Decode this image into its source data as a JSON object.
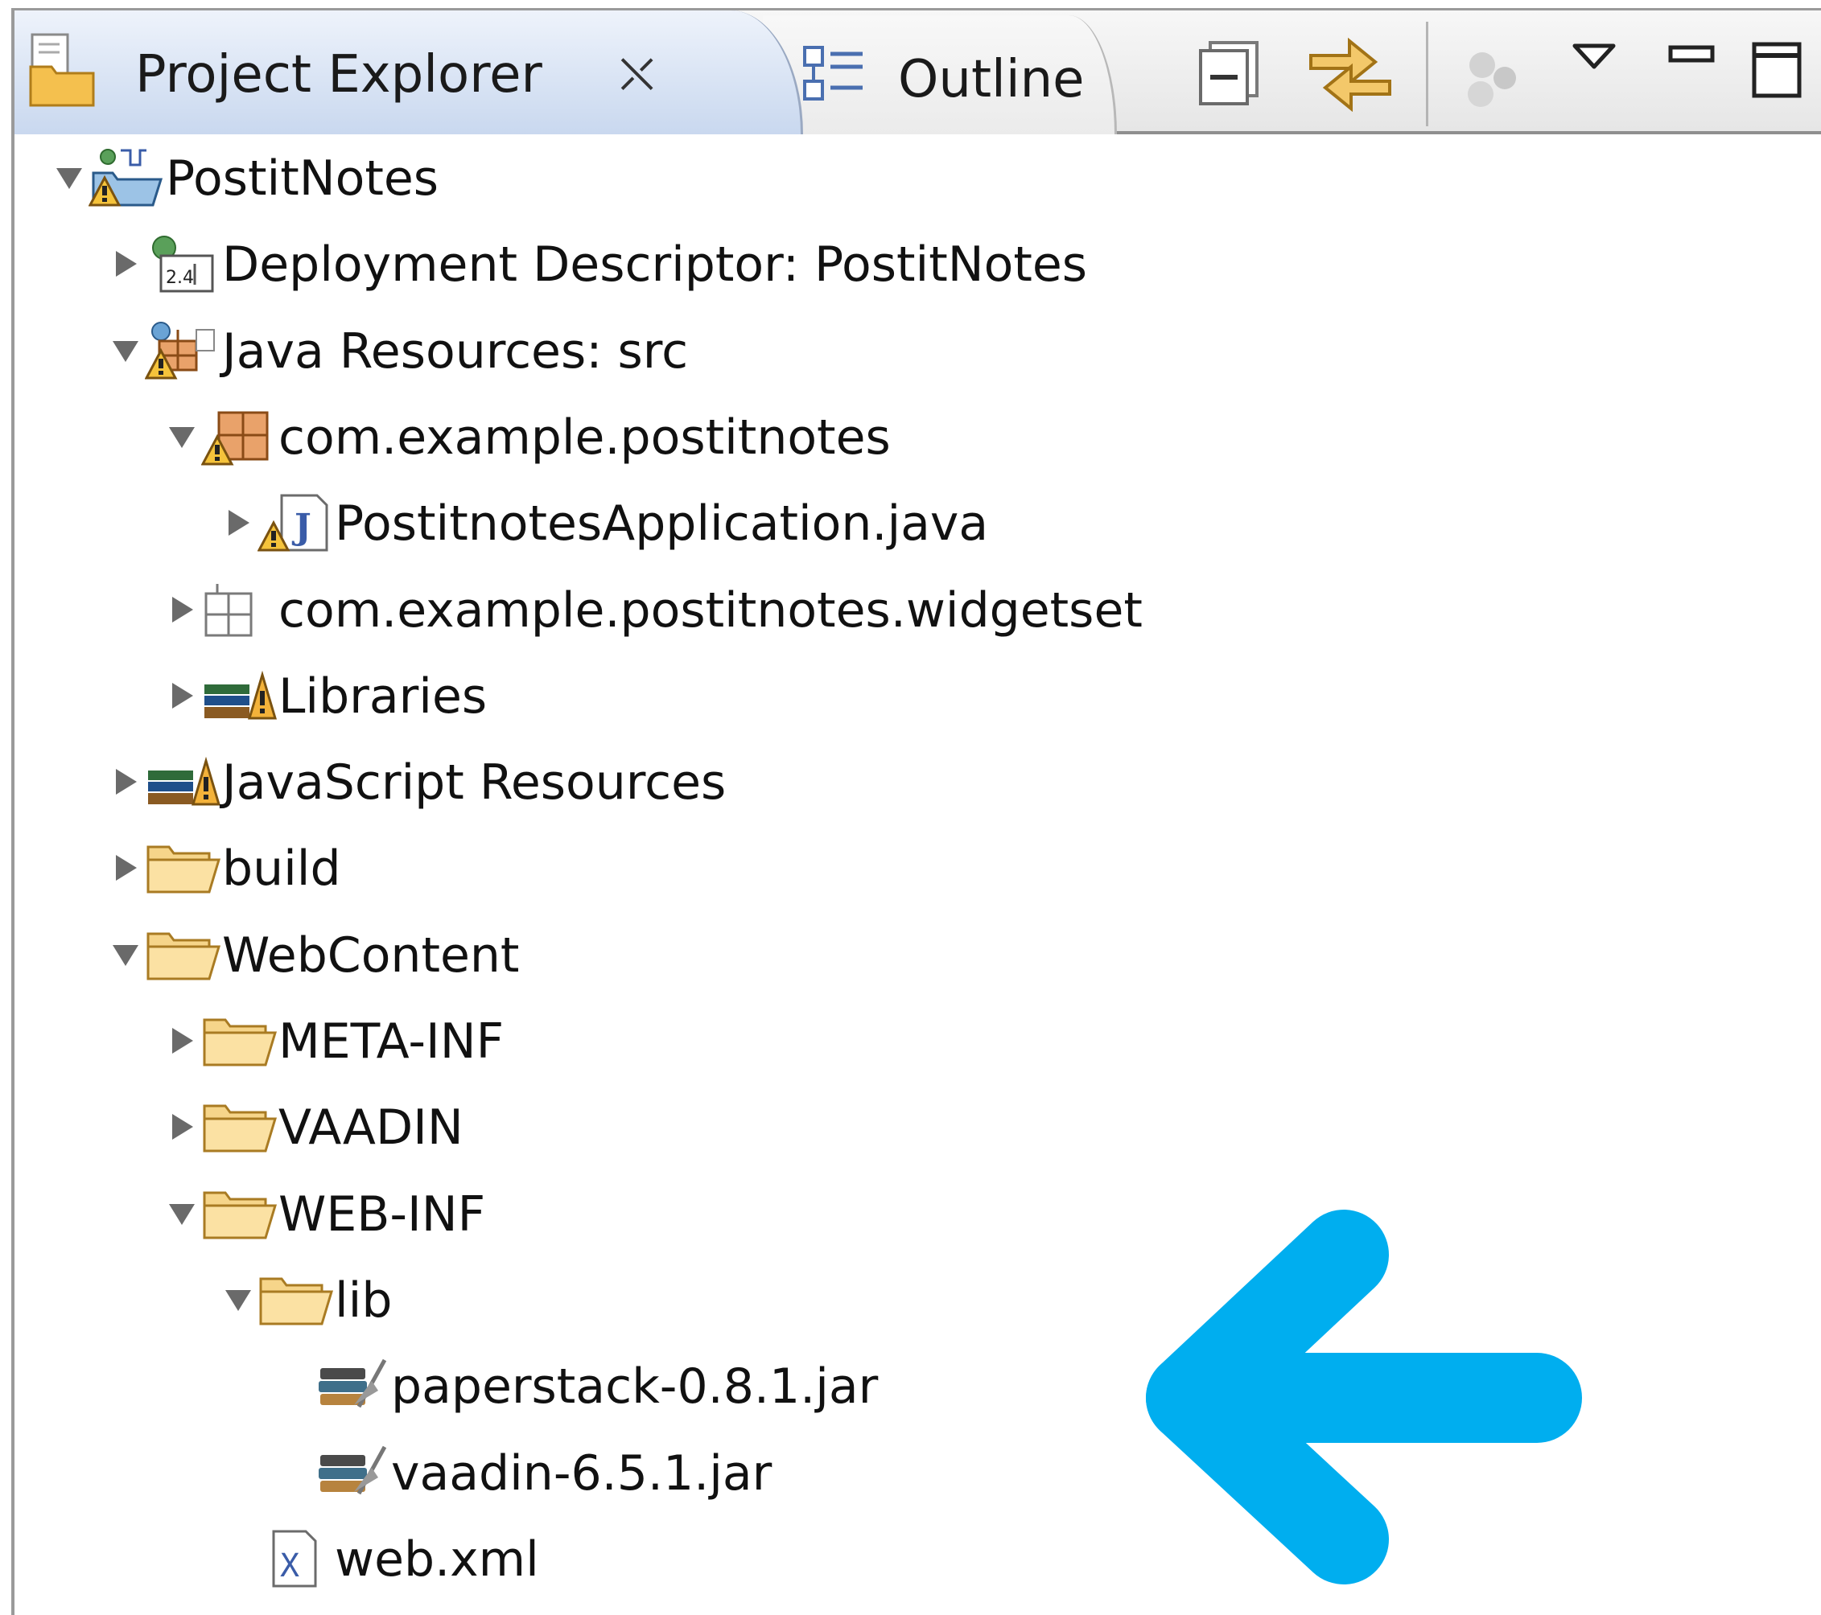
{
  "tabs": [
    {
      "label": "Project Explorer",
      "active": true,
      "icon": "project-explorer-icon"
    },
    {
      "label": "Outline",
      "active": false,
      "icon": "outline-icon"
    }
  ],
  "toolbar": [
    {
      "name": "collapse-all-icon"
    },
    {
      "name": "link-with-editor-icon"
    },
    {
      "name": "focus-icon"
    },
    {
      "name": "view-menu-chevron-icon"
    },
    {
      "name": "minimize-icon"
    },
    {
      "name": "maximize-icon"
    }
  ],
  "tree": [
    {
      "label": "PostitNotes",
      "level": 0,
      "state": "expanded",
      "icon": "web-project-icon"
    },
    {
      "label": "Deployment Descriptor: PostitNotes",
      "level": 1,
      "state": "collapsed",
      "icon": "deployment-descriptor-icon"
    },
    {
      "label": "Java Resources: src",
      "level": 1,
      "state": "expanded",
      "icon": "java-resources-icon"
    },
    {
      "label": "com.example.postitnotes",
      "level": 2,
      "state": "expanded",
      "icon": "package-icon"
    },
    {
      "label": "PostitnotesApplication.java",
      "level": 3,
      "state": "collapsed",
      "icon": "java-file-icon"
    },
    {
      "label": "com.example.postitnotes.widgetset",
      "level": 2,
      "state": "collapsed",
      "icon": "empty-package-icon"
    },
    {
      "label": "Libraries",
      "level": 2,
      "state": "collapsed",
      "icon": "libraries-icon"
    },
    {
      "label": "JavaScript Resources",
      "level": 1,
      "state": "collapsed",
      "icon": "libraries-icon"
    },
    {
      "label": "build",
      "level": 1,
      "state": "collapsed",
      "icon": "folder-icon"
    },
    {
      "label": "WebContent",
      "level": 1,
      "state": "expanded",
      "icon": "folder-icon"
    },
    {
      "label": "META-INF",
      "level": 2,
      "state": "collapsed",
      "icon": "folder-icon"
    },
    {
      "label": "VAADIN",
      "level": 2,
      "state": "collapsed",
      "icon": "folder-icon"
    },
    {
      "label": "WEB-INF",
      "level": 2,
      "state": "expanded",
      "icon": "folder-icon"
    },
    {
      "label": "lib",
      "level": 3,
      "state": "expanded",
      "icon": "folder-icon"
    },
    {
      "label": "paperstack-0.8.1.jar",
      "level": 4,
      "state": "leaf",
      "icon": "jar-icon"
    },
    {
      "label": "vaadin-6.5.1.jar",
      "level": 4,
      "state": "leaf",
      "icon": "jar-icon"
    },
    {
      "label": "web.xml",
      "level": 3,
      "state": "leaf",
      "icon": "xml-file-icon"
    }
  ],
  "annotation": {
    "name": "pointer-arrow",
    "color": "#00AEEF"
  }
}
